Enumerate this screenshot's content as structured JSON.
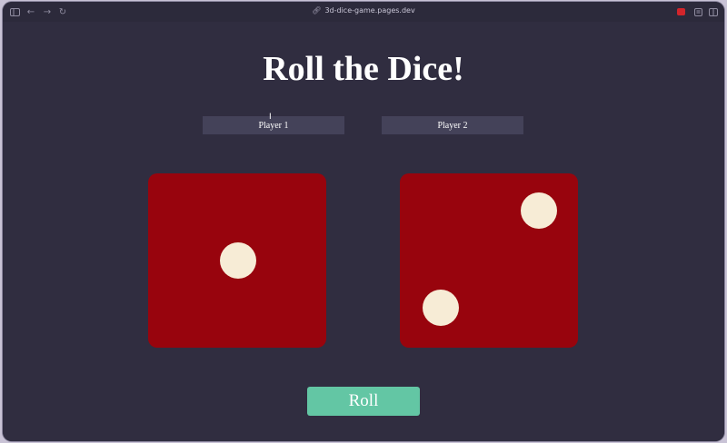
{
  "browser": {
    "url": "3d-dice-game.pages.dev",
    "icons": {
      "sidebar": "sidebar-icon",
      "back": "back-arrow-icon",
      "forward": "forward-arrow-icon",
      "reload": "reload-icon",
      "link": "link-icon",
      "extension": "extension-icon",
      "reader": "reader-icon",
      "tabs": "tab-overview-icon"
    }
  },
  "page": {
    "title": "Roll the Dice!",
    "players": [
      {
        "value": "Player 1"
      },
      {
        "value": "Player 2"
      }
    ],
    "dice": [
      {
        "face": 1,
        "color": "#98040d"
      },
      {
        "face": 2,
        "color": "#98040d"
      }
    ],
    "roll_label": "Roll",
    "colors": {
      "background": "#302d40",
      "die": "#98040d",
      "pip": "#f7ecd6",
      "button": "#63c6a4"
    }
  }
}
